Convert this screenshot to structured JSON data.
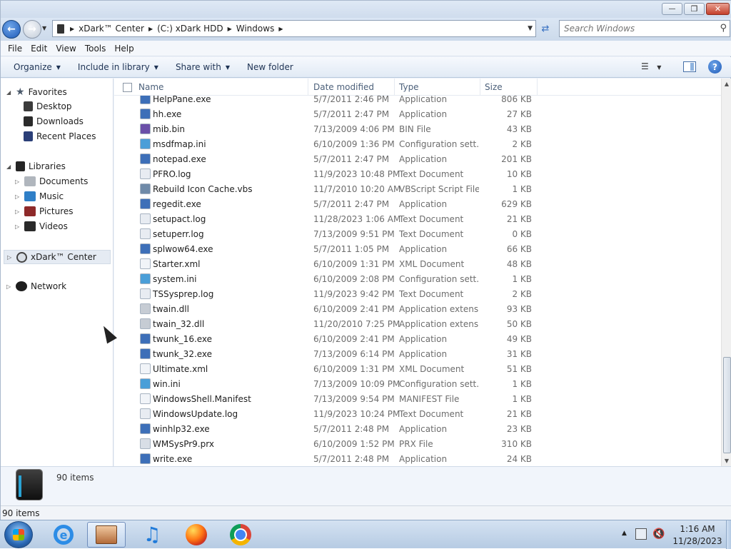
{
  "window": {
    "minimize_label": "—",
    "maximize_label": "❐",
    "close_label": "✕"
  },
  "address": {
    "crumbs": [
      "xDark™ Center",
      "(C:) xDark HDD",
      "Windows"
    ],
    "search_placeholder": "Search Windows"
  },
  "menu": [
    "File",
    "Edit",
    "View",
    "Tools",
    "Help"
  ],
  "toolbar": {
    "organize": "Organize",
    "include_in_library": "Include in library",
    "share_with": "Share with",
    "new_folder": "New folder"
  },
  "navpane": {
    "favorites": "Favorites",
    "desktop": "Desktop",
    "downloads": "Downloads",
    "recent_places": "Recent Places",
    "libraries": "Libraries",
    "documents": "Documents",
    "music": "Music",
    "pictures": "Pictures",
    "videos": "Videos",
    "xdark_center": "xDark™ Center",
    "network": "Network"
  },
  "columns": {
    "name": "Name",
    "date": "Date modified",
    "type": "Type",
    "size": "Size"
  },
  "files": [
    {
      "name": "HelpPane.exe",
      "date": "5/7/2011 2:46 PM",
      "type": "Application",
      "size": "806 KB"
    },
    {
      "name": "hh.exe",
      "date": "5/7/2011 2:47 PM",
      "type": "Application",
      "size": "27 KB"
    },
    {
      "name": "mib.bin",
      "date": "7/13/2009 4:06 PM",
      "type": "BIN File",
      "size": "43 KB"
    },
    {
      "name": "msdfmap.ini",
      "date": "6/10/2009 1:36 PM",
      "type": "Configuration sett...",
      "size": "2 KB"
    },
    {
      "name": "notepad.exe",
      "date": "5/7/2011 2:47 PM",
      "type": "Application",
      "size": "201 KB"
    },
    {
      "name": "PFRO.log",
      "date": "11/9/2023 10:48 PM",
      "type": "Text Document",
      "size": "10 KB"
    },
    {
      "name": "Rebuild Icon Cache.vbs",
      "date": "11/7/2010 10:20 AM",
      "type": "VBScript Script File",
      "size": "1 KB"
    },
    {
      "name": "regedit.exe",
      "date": "5/7/2011 2:47 PM",
      "type": "Application",
      "size": "629 KB"
    },
    {
      "name": "setupact.log",
      "date": "11/28/2023 1:06 AM",
      "type": "Text Document",
      "size": "21 KB"
    },
    {
      "name": "setuperr.log",
      "date": "7/13/2009 9:51 PM",
      "type": "Text Document",
      "size": "0 KB"
    },
    {
      "name": "splwow64.exe",
      "date": "5/7/2011 1:05 PM",
      "type": "Application",
      "size": "66 KB"
    },
    {
      "name": "Starter.xml",
      "date": "6/10/2009 1:31 PM",
      "type": "XML Document",
      "size": "48 KB"
    },
    {
      "name": "system.ini",
      "date": "6/10/2009 2:08 PM",
      "type": "Configuration sett...",
      "size": "1 KB"
    },
    {
      "name": "TSSysprep.log",
      "date": "11/9/2023 9:42 PM",
      "type": "Text Document",
      "size": "2 KB"
    },
    {
      "name": "twain.dll",
      "date": "6/10/2009 2:41 PM",
      "type": "Application extens...",
      "size": "93 KB"
    },
    {
      "name": "twain_32.dll",
      "date": "11/20/2010 7:25 PM",
      "type": "Application extens...",
      "size": "50 KB"
    },
    {
      "name": "twunk_16.exe",
      "date": "6/10/2009 2:41 PM",
      "type": "Application",
      "size": "49 KB"
    },
    {
      "name": "twunk_32.exe",
      "date": "7/13/2009 6:14 PM",
      "type": "Application",
      "size": "31 KB"
    },
    {
      "name": "Ultimate.xml",
      "date": "6/10/2009 1:31 PM",
      "type": "XML Document",
      "size": "51 KB"
    },
    {
      "name": "win.ini",
      "date": "7/13/2009 10:09 PM",
      "type": "Configuration sett...",
      "size": "1 KB"
    },
    {
      "name": "WindowsShell.Manifest",
      "date": "7/13/2009 9:54 PM",
      "type": "MANIFEST File",
      "size": "1 KB"
    },
    {
      "name": "WindowsUpdate.log",
      "date": "11/9/2023 10:24 PM",
      "type": "Text Document",
      "size": "21 KB"
    },
    {
      "name": "winhlp32.exe",
      "date": "5/7/2011 2:48 PM",
      "type": "Application",
      "size": "23 KB"
    },
    {
      "name": "WMSysPr9.prx",
      "date": "6/10/2009 1:52 PM",
      "type": "PRX File",
      "size": "310 KB"
    },
    {
      "name": "write.exe",
      "date": "5/7/2011 2:48 PM",
      "type": "Application",
      "size": "24 KB"
    }
  ],
  "details": {
    "count": "90 items"
  },
  "status": {
    "text": "90 items"
  },
  "clock": {
    "time": "1:16 AM",
    "date": "11/28/2023"
  }
}
